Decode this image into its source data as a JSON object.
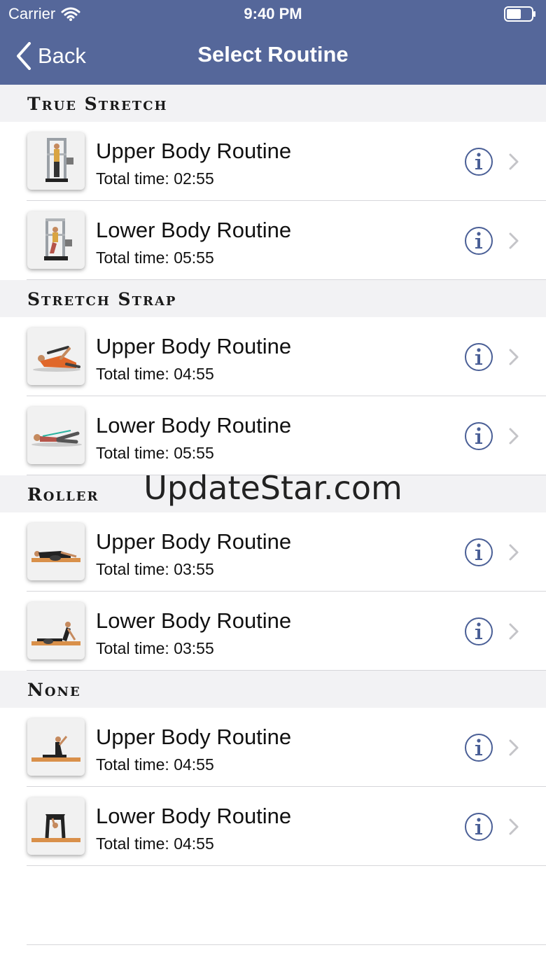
{
  "status_bar": {
    "carrier": "Carrier",
    "time": "9:40 PM"
  },
  "nav": {
    "back_label": "Back",
    "title": "Select Routine"
  },
  "sections": [
    {
      "header": "True Stretch",
      "rows": [
        {
          "title": "Upper Body Routine",
          "subtitle": "Total time: 02:55",
          "thumb": "true-stretch-upper"
        },
        {
          "title": "Lower Body Routine",
          "subtitle": "Total time: 05:55",
          "thumb": "true-stretch-lower"
        }
      ]
    },
    {
      "header": "Stretch Strap",
      "rows": [
        {
          "title": "Upper Body Routine",
          "subtitle": "Total time: 04:55",
          "thumb": "strap-upper"
        },
        {
          "title": "Lower Body Routine",
          "subtitle": "Total time: 05:55",
          "thumb": "strap-lower"
        }
      ]
    },
    {
      "header": "Roller",
      "rows": [
        {
          "title": "Upper Body Routine",
          "subtitle": "Total time: 03:55",
          "thumb": "roller-upper"
        },
        {
          "title": "Lower Body Routine",
          "subtitle": "Total time: 03:55",
          "thumb": "roller-lower"
        }
      ]
    },
    {
      "header": "None",
      "rows": [
        {
          "title": "Upper Body Routine",
          "subtitle": "Total time: 04:55",
          "thumb": "none-upper"
        },
        {
          "title": "Lower Body Routine",
          "subtitle": "Total time: 04:55",
          "thumb": "none-lower"
        }
      ]
    }
  ],
  "watermark": "UpdateStar.com",
  "colors": {
    "nav_background": "#55679a",
    "section_background": "#f2f2f4",
    "info_icon": "#4a5f96",
    "chevron": "#c4c4c8"
  }
}
